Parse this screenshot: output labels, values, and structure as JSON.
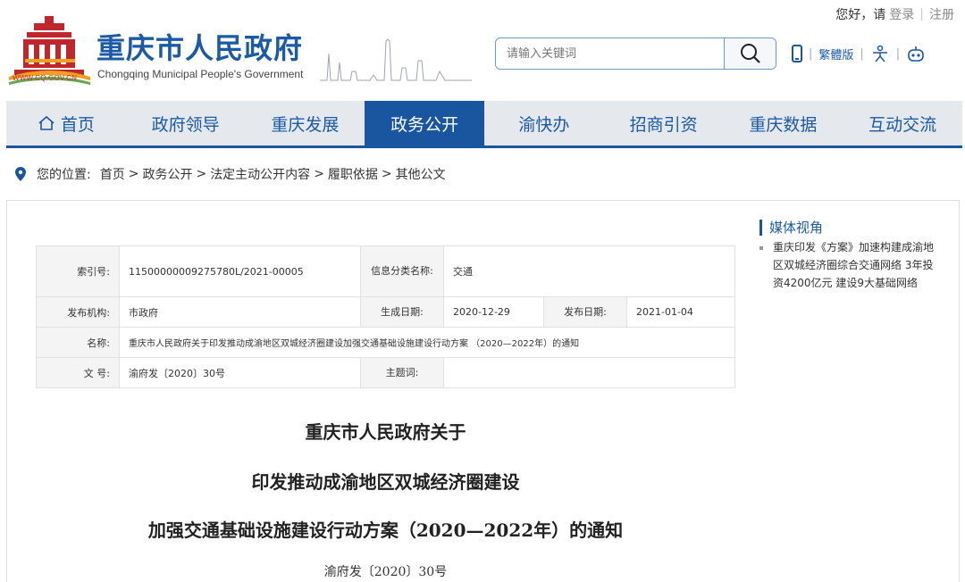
{
  "header": {
    "greeting": "您好，请",
    "login": "登录",
    "register": "注册",
    "site_title": "重庆市人民政府",
    "site_subtitle": "Chongqing Municipal People's Government",
    "logo_url": "WWW.CQ.GOV.CN",
    "search_placeholder": "请输入关键词",
    "traditional": "繁體版"
  },
  "nav": {
    "items": [
      {
        "label": "首页"
      },
      {
        "label": "政府领导"
      },
      {
        "label": "重庆发展"
      },
      {
        "label": "政务公开"
      },
      {
        "label": "渝快办"
      },
      {
        "label": "招商引资"
      },
      {
        "label": "重庆数据"
      },
      {
        "label": "互动交流"
      }
    ],
    "active_index": 3
  },
  "breadcrumb": {
    "prefix": "您的位置:",
    "items": [
      "首页",
      "政务公开",
      "法定主动公开内容",
      "履职依据",
      "其他公文"
    ]
  },
  "info": {
    "index_label": "索引号:",
    "index_value": "11500000009275780L/2021-00005",
    "category_label": "信息分类名称:",
    "category_value": "交通",
    "issuer_label": "发布机构:",
    "issuer_value": "市政府",
    "created_label": "生成日期:",
    "created_value": "2020-12-29",
    "published_label": "发布日期:",
    "published_value": "2021-01-04",
    "name_label": "名称:",
    "name_value": "重庆市人民政府关于印发推动成渝地区双城经济圈建设加强交通基础设施建设行动方案 （2020—2022年）的通知",
    "docno_label": "文 号:",
    "docno_value": "渝府发〔2020〕30号",
    "topic_label": "主题词:",
    "topic_value": ""
  },
  "document": {
    "title_line1": "重庆市人民政府关于",
    "title_line2": "印发推动成渝地区双城经济圈建设",
    "title_line3": "加强交通基础设施建设行动方案（2020—2022年）的通知",
    "doc_number": "渝府发〔2020〕30号"
  },
  "sidebar": {
    "heading": "媒体视角",
    "items": [
      "重庆印发《方案》加速构建成渝地区双城经济圈综合交通网络 3年投资4200亿元 建设9大基础网络"
    ]
  },
  "colors": {
    "primary": "#1a56a0",
    "logo_red": "#c0272d",
    "logo_orange": "#f0a020"
  }
}
